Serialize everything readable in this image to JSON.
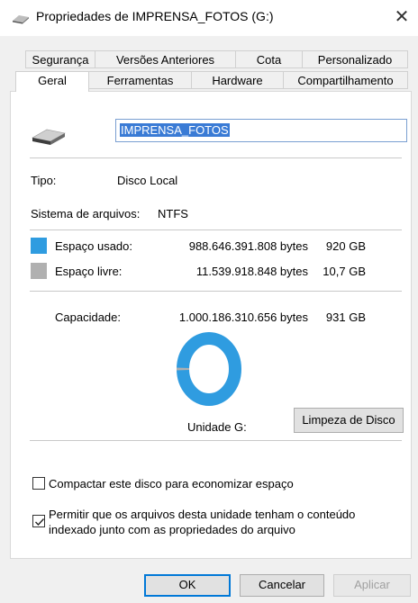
{
  "window": {
    "title": "Propriedades de IMPRENSA_FOTOS (G:)",
    "close_symbol": "✕"
  },
  "tabs_row1": [
    "Segurança",
    "Versões Anteriores",
    "Cota",
    "Personalizado"
  ],
  "tabs_row2": [
    "Geral",
    "Ferramentas",
    "Hardware",
    "Compartilhamento"
  ],
  "active_tab": "Geral",
  "drive": {
    "name": "IMPRENSA_FOTOS"
  },
  "info": {
    "type_label": "Tipo:",
    "type_value": "Disco Local",
    "fs_label": "Sistema de arquivos:",
    "fs_value": "NTFS"
  },
  "usage": {
    "used_label": "Espaço usado:",
    "used_bytes": "988.646.391.808 bytes",
    "used_gb": "920 GB",
    "free_label": "Espaço livre:",
    "free_bytes": "11.539.918.848 bytes",
    "free_gb": "10,7 GB",
    "capacity_label": "Capacidade:",
    "capacity_bytes": "1.000.186.310.656 bytes",
    "capacity_gb": "931 GB",
    "used_fraction": 0.9885,
    "used_color": "#2f9ce0",
    "free_color": "#b0b0b0"
  },
  "unit_label": "Unidade G:",
  "cleanup_button": "Limpeza de Disco",
  "options": {
    "compress_label": "Compactar este disco para economizar espaço",
    "compress_checked": false,
    "index_label_line1": "Permitir que os arquivos desta unidade tenham o conteúdo",
    "index_label_line2": "indexado junto com as propriedades do arquivo",
    "index_checked": true
  },
  "buttons": {
    "ok": "OK",
    "cancel": "Cancelar",
    "apply": "Aplicar"
  }
}
